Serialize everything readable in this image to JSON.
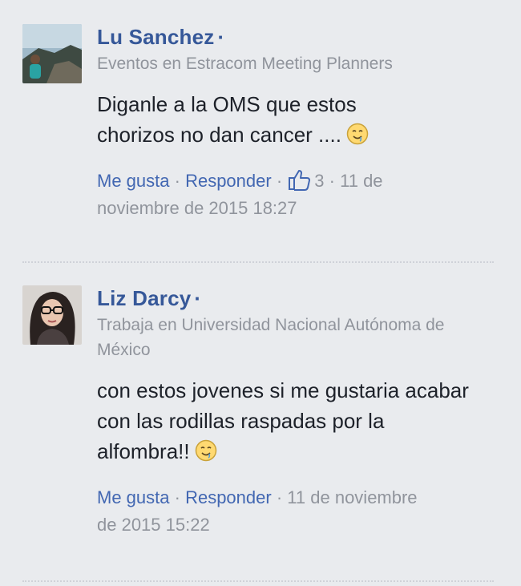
{
  "comments": [
    {
      "author": "Lu Sanchez",
      "dot": "·",
      "subtitle": "Eventos en Estracom Meeting Planners",
      "text": "Diganle a la OMS que estos chorizos no dan cancer ....",
      "emoji": "drooling-face",
      "actions": {
        "like": "Me gusta",
        "reply": "Responder",
        "like_count": "3",
        "timestamp": "11 de noviembre de 2015 18:27"
      }
    },
    {
      "author": "Liz Darcy",
      "dot": "·",
      "subtitle": "Trabaja en Universidad Nacional Autónoma de México",
      "text": "con estos jovenes si me gustaria acabar con las rodillas raspadas por la alfombra!!",
      "emoji": "drooling-face",
      "actions": {
        "like": "Me gusta",
        "reply": "Responder",
        "timestamp": "11 de noviembre de 2015 15:22"
      }
    }
  ],
  "colors": {
    "background": "#e9ebee",
    "name": "#365899",
    "link": "#4267b2",
    "meta": "#90949c",
    "text": "#1d2129"
  }
}
